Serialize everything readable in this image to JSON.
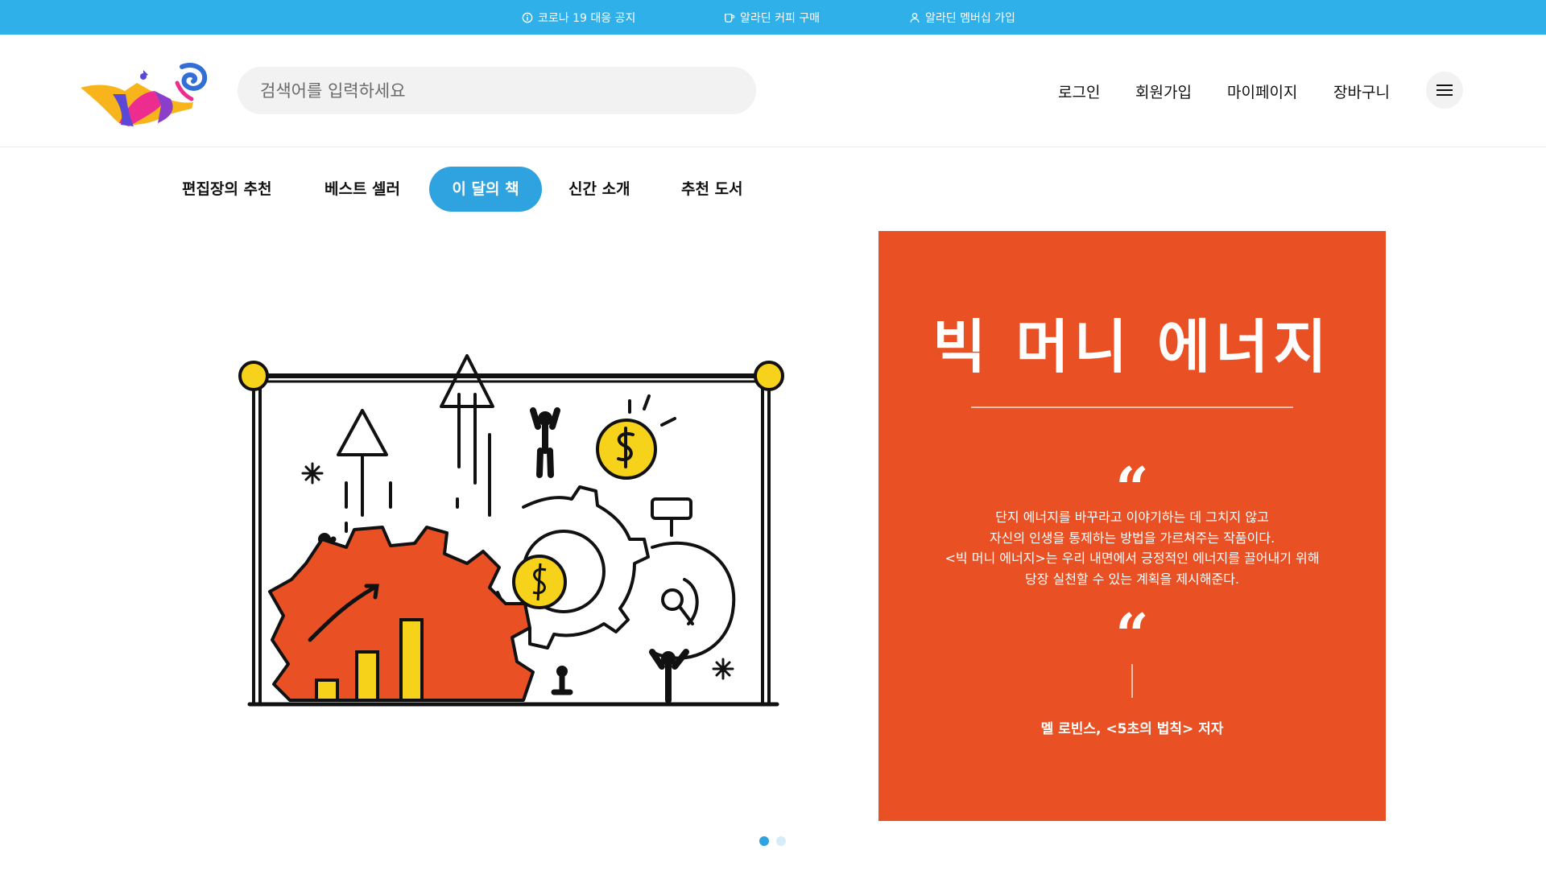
{
  "topbar": {
    "background": "#2fb0e9",
    "notices": [
      {
        "label": "코로나 19 대응 공지",
        "icon": "info-icon"
      },
      {
        "label": "알라딘 커피 구매",
        "icon": "coffee-cup-icon"
      },
      {
        "label": "알라딘 멤버십 가입",
        "icon": "person-icon"
      }
    ]
  },
  "header": {
    "logo": "aladdin-lamp-logo",
    "search": {
      "placeholder": "검색어를 입력하세요",
      "value": ""
    },
    "nav": {
      "login": "로그인",
      "join": "회원가입",
      "mypage": "마이페이지",
      "cart": "장바구니"
    },
    "menu_icon": "hamburger-menu-icon"
  },
  "tabs": [
    {
      "label": "편집장의 추천",
      "active": false
    },
    {
      "label": "베스트 셀러",
      "active": false
    },
    {
      "label": "이 달의 책",
      "active": true
    },
    {
      "label": "신간 소개",
      "active": false
    },
    {
      "label": "추천 도서",
      "active": false
    }
  ],
  "accent_color": "#2fa3e0",
  "book": {
    "title": "빅 머니 에너지",
    "card_color": "#e95125",
    "quote_mark": "“",
    "description": [
      "단지 에너지를 바꾸라고 이야기하는 데 그치지 않고",
      "자신의 인생을 통제하는 방법을 가르쳐주는 작품이다.",
      "<빅 머니 에너지>는 우리 내면에서 긍정적인 에너지를 끌어내기 위해",
      "당장 실천할 수 있는 계획을 제시해준다."
    ],
    "author": "멜 로빈스, <5초의 법칙> 저자"
  },
  "pager": {
    "total": 2,
    "current": 1
  }
}
